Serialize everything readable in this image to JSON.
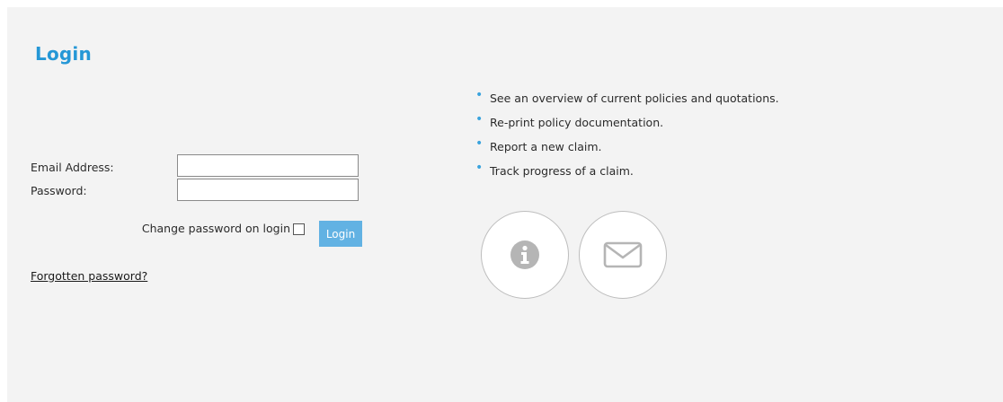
{
  "login": {
    "title": "Login",
    "email_label": "Email Address:",
    "email_value": "",
    "password_label": "Password:",
    "password_value": "",
    "change_password_label": "Change password on login",
    "change_password_checked": false,
    "login_button_label": "Login",
    "forgot_password_link": "Forgotten password?"
  },
  "features": {
    "items": [
      "See an overview of current policies and quotations.",
      "Re-print policy documentation.",
      "Report a new claim.",
      "Track progress of a claim."
    ]
  },
  "icons": {
    "info": "info-icon",
    "email": "envelope-icon",
    "bullet": "bullet-icon"
  },
  "colors": {
    "accent": "#2597d6",
    "button": "#62b2e3",
    "panel_background": "#f3f3f3",
    "icon_gray": "#b5b5b5"
  }
}
